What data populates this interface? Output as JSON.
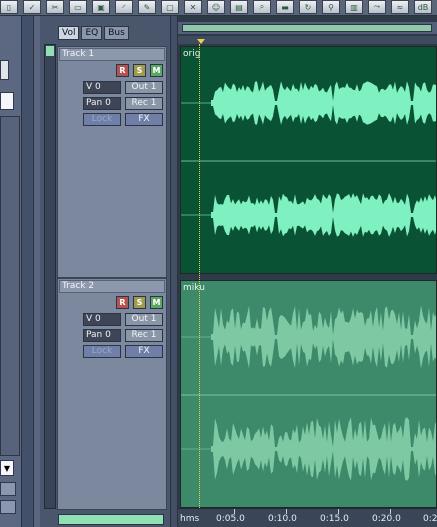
{
  "toolbar": {
    "icons": [
      "document-icon",
      "checkmark-icon",
      "scissors-icon",
      "page-icon",
      "save-icon",
      "curve-tool-icon",
      "pencil-icon",
      "select-icon",
      "cross-icon",
      "person-icon",
      "lock-icon",
      "zoom-icon",
      "clip-icon",
      "loop-icon",
      "search-icon",
      "meter-icon",
      "route-icon",
      "wave-icon",
      "db-icon"
    ]
  },
  "left_panel": {
    "select_arrow": "▼"
  },
  "tabs": [
    {
      "label": "Vol",
      "active": true
    },
    {
      "label": "EQ",
      "active": false
    },
    {
      "label": "Bus",
      "active": false
    }
  ],
  "tracks": [
    {
      "name": "Track 1",
      "record": "R",
      "solo": "S",
      "mute": "M",
      "volume": "V 0",
      "pan": "Pan 0",
      "output": "Out 1",
      "input": "Rec 1",
      "lock": "Lock",
      "fx": "FX",
      "clip_label": "orig"
    },
    {
      "name": "Track 2",
      "record": "R",
      "solo": "S",
      "mute": "M",
      "volume": "V 0",
      "pan": "Pan 0",
      "output": "Out 1",
      "input": "Rec 1",
      "lock": "Lock",
      "fx": "FX",
      "clip_label": "miku"
    }
  ],
  "ruler": {
    "unit": "hms",
    "labels": [
      "0:05.0",
      "0:10.0",
      "0:15.0",
      "0:20.0",
      "0:2"
    ]
  },
  "colors": {
    "clip_selected_bg": "#0a5234",
    "clip_unselected_bg": "#3c8a6a",
    "waveform_selected": "#7ff0c0",
    "waveform_unselected": "#7ec8a4",
    "cursor": "#e8d24a"
  }
}
